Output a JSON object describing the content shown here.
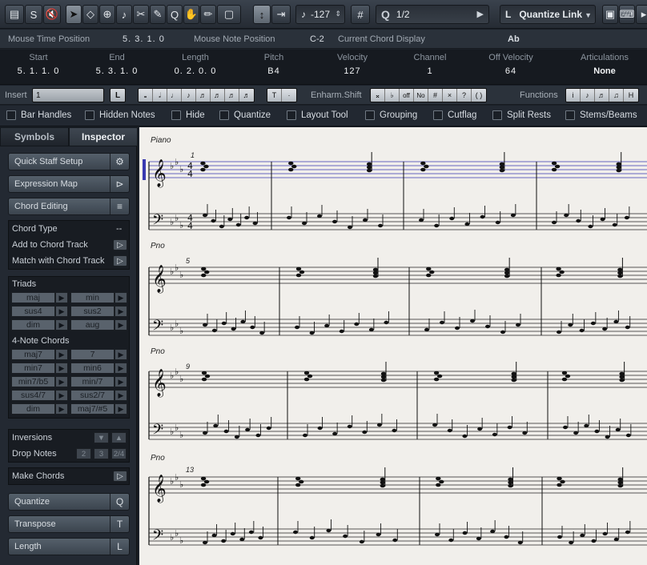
{
  "toolbar": {
    "pitch_value": "-127",
    "grid_label": "#",
    "quantize_value": "1/2",
    "quantize_link_label": "L",
    "quantize_link_value": "Quantize Link"
  },
  "info": {
    "mouse_time_label": "Mouse Time Position",
    "mouse_time_value": "5. 3. 1.   0",
    "mouse_note_label": "Mouse Note Position",
    "mouse_note_value": "C-2",
    "chord_label": "Current Chord Display",
    "chord_value": "Ab"
  },
  "event": {
    "start_label": "Start",
    "start_value": "5. 1. 1.   0",
    "end_label": "End",
    "end_value": "5. 3. 1.   0",
    "length_label": "Length",
    "length_value": "0. 2. 0.   0",
    "pitch_label": "Pitch",
    "pitch_value": "B4",
    "velocity_label": "Velocity",
    "velocity_value": "127",
    "channel_label": "Channel",
    "channel_value": "1",
    "offvel_label": "Off Velocity",
    "offvel_value": "64",
    "artic_label": "Articulations",
    "artic_value": "None"
  },
  "insert": {
    "insert_label": "Insert",
    "insert_value": "1",
    "l_label": "L",
    "t_label": "T",
    "dot_label": "·",
    "enharm_label": "Enharm.Shift",
    "enharm_buttons": [
      "𝄪",
      "♭",
      "off",
      "No",
      "#",
      "×",
      "?",
      "( )"
    ],
    "functions_label": "Functions",
    "func_i": "i"
  },
  "filters": [
    "Bar Handles",
    "Hidden Notes",
    "Hide",
    "Quantize",
    "Layout Tool",
    "Grouping",
    "Cutflag",
    "Split Rests",
    "Stems/Beams"
  ],
  "tabs": {
    "symbols": "Symbols",
    "inspector": "Inspector"
  },
  "panel": {
    "quick_staff": "Quick Staff Setup",
    "expression_map": "Expression Map",
    "chord_editing": "Chord Editing",
    "chord_type": "Chord Type",
    "chord_type_value": "--",
    "add_to_chord_track": "Add to Chord Track",
    "match_chord_track": "Match with Chord Track",
    "triads_label": "Triads",
    "triads": [
      "maj",
      "min",
      "sus4",
      "sus2",
      "dim",
      "aug"
    ],
    "four_note_label": "4-Note Chords",
    "four_note": [
      "maj7",
      "7",
      "min7",
      "min6",
      "min7/b5",
      "min/7",
      "sus4/7",
      "sus2/7",
      "dim",
      "maj7/#5"
    ],
    "inversions": "Inversions",
    "drop_notes": "Drop Notes",
    "drop_values": [
      "2",
      "3",
      "2/4"
    ],
    "make_chords": "Make Chords",
    "quantize": "Quantize",
    "quantize_key": "Q",
    "transpose": "Transpose",
    "transpose_key": "T",
    "length": "Length",
    "length_key": "L"
  },
  "score": {
    "staff_labels": [
      "Piano",
      "Pno",
      "Pno",
      "Pno"
    ],
    "bar_numbers": [
      "1",
      "5",
      "9",
      "13"
    ]
  }
}
